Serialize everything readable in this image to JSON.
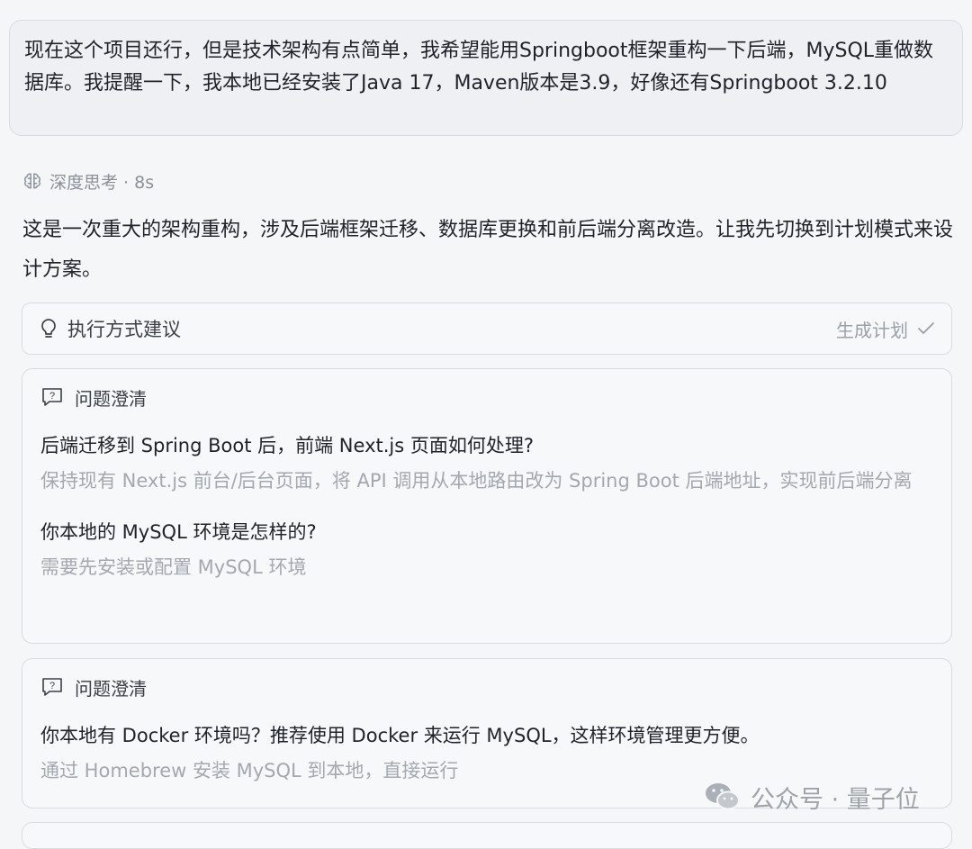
{
  "user_message": "现在这个项目还行，但是技术架构有点简单，我希望能用Springboot框架重构一下后端，MySQL重做数据库。我提醒一下，我本地已经安装了Java 17，Maven版本是3.9，好像还有Springboot 3.2.10",
  "thinking": {
    "label": "深度思考 · 8s",
    "icon": "brain-icon"
  },
  "reply": "这是一次重大的架构重构，涉及后端框架迁移、数据库更换和前后端分离改造。让我先切换到计划模式来设计方案。",
  "suggestion": {
    "title": "执行方式建议",
    "action_label": "生成计划",
    "icon": "lightbulb-icon"
  },
  "qa_cards": [
    {
      "header": "问题澄清",
      "items": [
        {
          "question": "后端迁移到 Spring Boot 后，前端 Next.js 页面如何处理?",
          "answer": "保持现有 Next.js 前台/后台页面，将 API 调用从本地路由改为 Spring Boot 后端地址，实现前后端分离"
        },
        {
          "question": "你本地的 MySQL 环境是怎样的?",
          "answer": "需要先安装或配置 MySQL 环境"
        }
      ]
    },
    {
      "header": "问题澄清",
      "items": [
        {
          "question": "你本地有 Docker 环境吗？推荐使用 Docker 来运行 MySQL，这样环境管理更方便。",
          "answer": "通过 Homebrew 安装 MySQL 到本地，直接运行"
        }
      ]
    }
  ],
  "watermark": "公众号 · 量子位"
}
